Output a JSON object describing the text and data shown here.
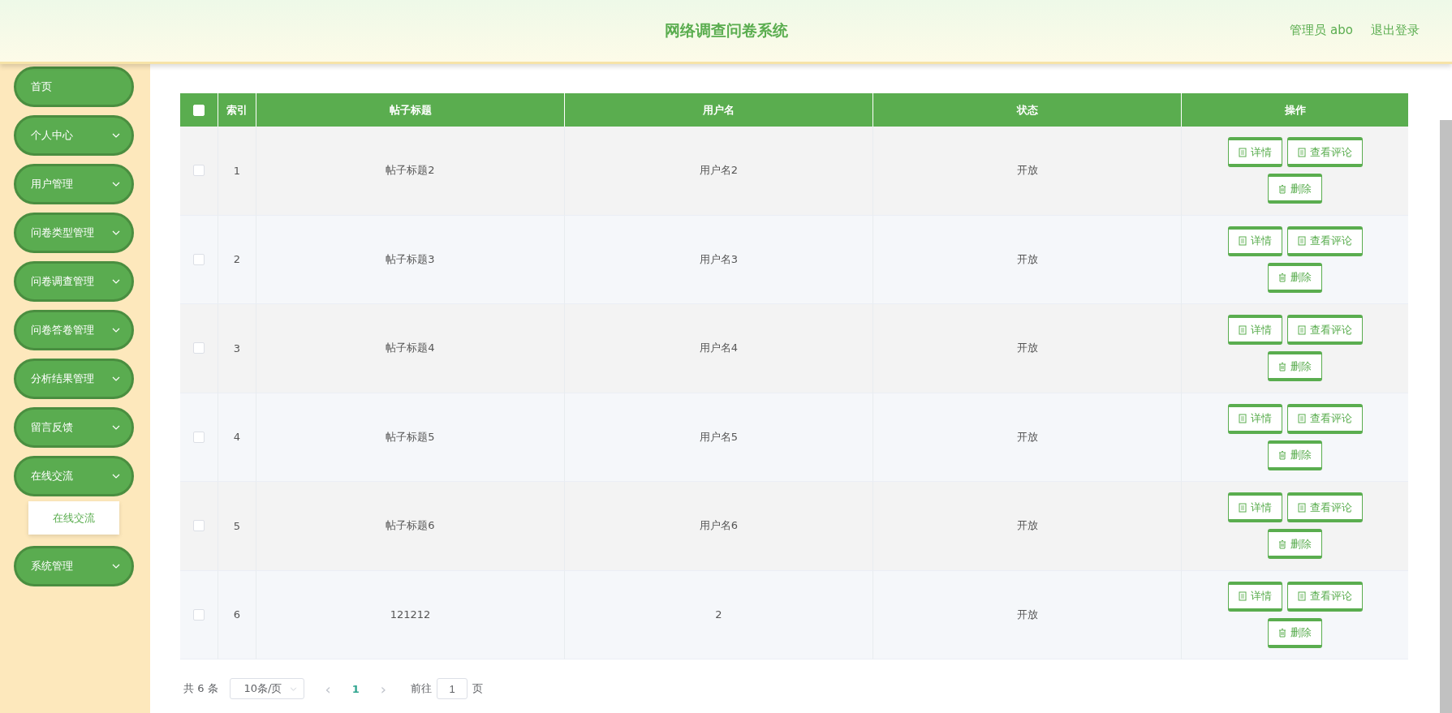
{
  "header": {
    "title": "网络调查问卷系统",
    "user": "管理员 abo",
    "logout": "退出登录"
  },
  "sidebar": {
    "items": [
      {
        "kind": "link",
        "label": "首页"
      },
      {
        "kind": "submenu",
        "label": "个人中心"
      },
      {
        "kind": "submenu",
        "label": "用户管理"
      },
      {
        "kind": "submenu",
        "label": "问卷类型管理"
      },
      {
        "kind": "submenu",
        "label": "问卷调查管理"
      },
      {
        "kind": "submenu",
        "label": "问卷答卷管理"
      },
      {
        "kind": "submenu",
        "label": "分析结果管理"
      },
      {
        "kind": "submenu",
        "label": "留言反馈"
      },
      {
        "kind": "submenu",
        "label": "在线交流",
        "children": [
          {
            "label": "在线交流"
          }
        ]
      },
      {
        "kind": "submenu",
        "label": "系统管理"
      }
    ]
  },
  "table": {
    "select_all": {
      "checked": false
    },
    "columns": [
      "索引",
      "帖子标题",
      "用户名",
      "状态",
      "操作"
    ],
    "rows": [
      {
        "checked": false,
        "index": "1",
        "title": "帖子标题2",
        "user": "用户名2",
        "status": "开放",
        "actions": [
          {
            "kind": "doc",
            "label": "详情"
          },
          {
            "kind": "doc",
            "label": "查看评论"
          },
          {
            "kind": "trash",
            "label": "删除"
          }
        ]
      },
      {
        "checked": false,
        "index": "2",
        "title": "帖子标题3",
        "user": "用户名3",
        "status": "开放",
        "actions": [
          {
            "kind": "doc",
            "label": "详情"
          },
          {
            "kind": "doc",
            "label": "查看评论"
          },
          {
            "kind": "trash",
            "label": "删除"
          }
        ]
      },
      {
        "checked": false,
        "index": "3",
        "title": "帖子标题4",
        "user": "用户名4",
        "status": "开放",
        "actions": [
          {
            "kind": "doc",
            "label": "详情"
          },
          {
            "kind": "doc",
            "label": "查看评论"
          },
          {
            "kind": "trash",
            "label": "删除"
          }
        ]
      },
      {
        "checked": false,
        "index": "4",
        "title": "帖子标题5",
        "user": "用户名5",
        "status": "开放",
        "actions": [
          {
            "kind": "doc",
            "label": "详情"
          },
          {
            "kind": "doc",
            "label": "查看评论"
          },
          {
            "kind": "trash",
            "label": "删除"
          }
        ]
      },
      {
        "checked": false,
        "index": "5",
        "title": "帖子标题6",
        "user": "用户名6",
        "status": "开放",
        "actions": [
          {
            "kind": "doc",
            "label": "详情"
          },
          {
            "kind": "doc",
            "label": "查看评论"
          },
          {
            "kind": "trash",
            "label": "删除"
          }
        ]
      },
      {
        "checked": false,
        "index": "6",
        "title": "121212",
        "user": "2",
        "status": "开放",
        "actions": [
          {
            "kind": "doc",
            "label": "详情"
          },
          {
            "kind": "doc",
            "label": "查看评论"
          },
          {
            "kind": "trash",
            "label": "删除"
          }
        ]
      }
    ]
  },
  "pagination": {
    "total": "共 6 条",
    "page_size": "10条/页",
    "prev": "‹",
    "pages": [
      {
        "label": "1",
        "selected": true
      }
    ],
    "next": "›",
    "goto": "前往",
    "goto_value": "1",
    "goto_unit": "页"
  }
}
